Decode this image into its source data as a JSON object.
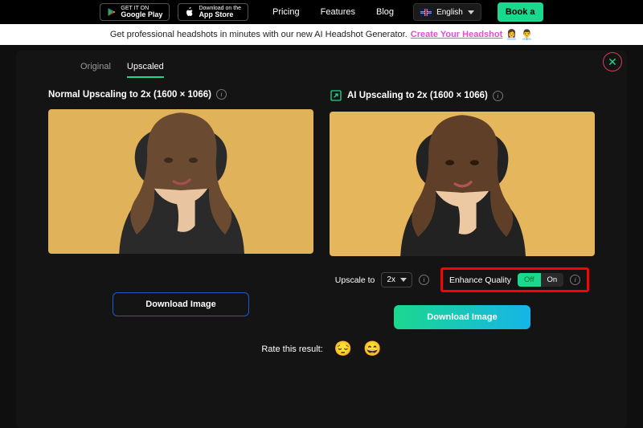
{
  "nav": {
    "gplay_small": "GET IT ON",
    "gplay_big": "Google Play",
    "appstore_small": "Download on the",
    "appstore_big": "App Store",
    "links": [
      "Pricing",
      "Features",
      "Blog"
    ],
    "lang": "English",
    "book": "Book a"
  },
  "promo": {
    "text": "Get professional headshots in minutes with our new AI Headshot Generator.",
    "link": "Create Your Headshot"
  },
  "tabs": {
    "original": "Original",
    "upscaled": "Upscaled"
  },
  "left": {
    "title": "Normal Upscaling to 2x (1600 × 1066)",
    "download": "Download Image"
  },
  "right": {
    "title": "AI Upscaling to 2x (1600 × 1066)",
    "upscale_label": "Upscale to",
    "upscale_value": "2x",
    "enhance_label": "Enhance Quality",
    "toggle_off": "Off",
    "toggle_on": "On",
    "download": "Download Image"
  },
  "rate": {
    "label": "Rate this result:"
  }
}
